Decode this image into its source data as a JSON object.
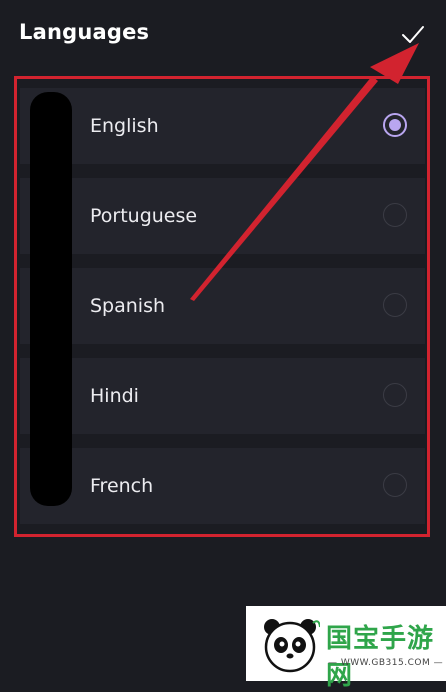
{
  "header": {
    "title": "Languages",
    "confirm_icon": "checkmark-icon"
  },
  "languages": [
    {
      "label": "English",
      "selected": true
    },
    {
      "label": "Portuguese",
      "selected": false
    },
    {
      "label": "Spanish",
      "selected": false
    },
    {
      "label": "Hindi",
      "selected": false
    },
    {
      "label": "French",
      "selected": false
    }
  ],
  "annotation": {
    "box_color": "#d2232f",
    "arrow_color": "#d2232f"
  },
  "watermark": {
    "name": "国宝手游网",
    "url": "— WWW.GB315.COM —"
  },
  "colors": {
    "background": "#1b1c22",
    "row": "#23242c",
    "accent": "#b9a6f0"
  }
}
